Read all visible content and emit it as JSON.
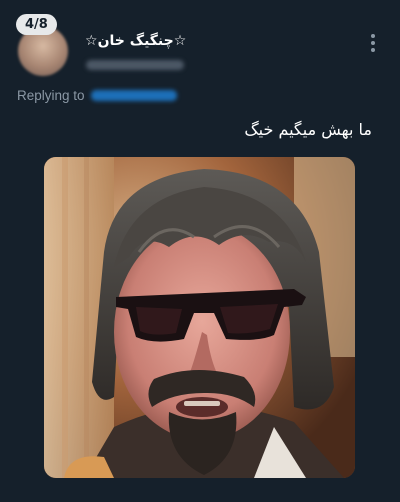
{
  "thread_counter": "4/8",
  "author": {
    "display_name": "☆چنگیگ خان☆"
  },
  "reply": {
    "label": "Replying to"
  },
  "tweet": {
    "text": "ما بهش میگیم خیگ"
  },
  "icons": {
    "more": "more-vertical-icon",
    "avatar": "avatar-image"
  },
  "colors": {
    "background": "#15202b",
    "text_primary": "#ffffff",
    "text_secondary": "#8b98a5",
    "link": "#1d9bf0"
  }
}
